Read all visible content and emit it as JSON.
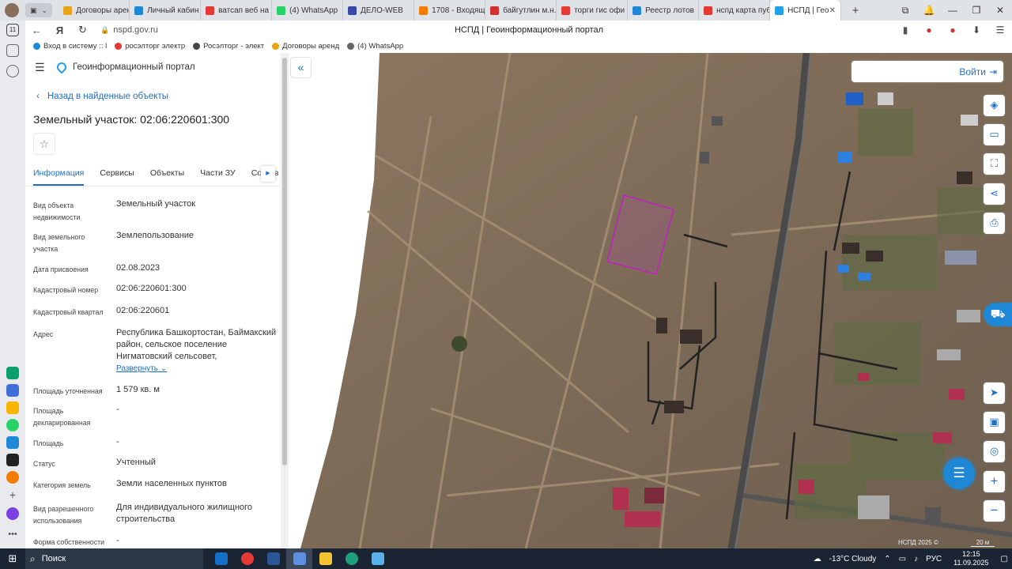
{
  "browser": {
    "tabs": [
      {
        "label": "Договоры арен",
        "color": "#e8a317"
      },
      {
        "label": "Личный кабин",
        "color": "#1e88d6"
      },
      {
        "label": "ватсап веб на",
        "color": "#e53935"
      },
      {
        "label": "(4) WhatsApp",
        "color": "#25d366"
      },
      {
        "label": "ДЕЛО-WEB",
        "color": "#3949ab"
      },
      {
        "label": "1708 - Входящ",
        "color": "#f57c00"
      },
      {
        "label": "байгутлин м.н.",
        "color": "#d32f2f"
      },
      {
        "label": "торги гис офи",
        "color": "#e53935"
      },
      {
        "label": "Реестр лотов",
        "color": "#1e88d6"
      },
      {
        "label": "нспд карта пуб",
        "color": "#e53935"
      }
    ],
    "active_tab": {
      "label": "НСПД | Гео",
      "color": "#1fa0e8"
    },
    "new_tab": "+",
    "url": "nspd.gov.ru",
    "page_title": "НСПД | Геоинформационный портал",
    "bookmarks": [
      {
        "label": "Вход в систему :: l",
        "color": "#1e88d6"
      },
      {
        "label": "росэлторг электр",
        "color": "#e53935"
      },
      {
        "label": "Росэлторг - элект",
        "color": "#444"
      },
      {
        "label": "Договоры аренд",
        "color": "#e8a317"
      },
      {
        "label": "(4) WhatsApp",
        "color": "#666"
      }
    ]
  },
  "portal": {
    "title": "Геоинформационный портал",
    "back_label": "Назад в найденные объекты",
    "object_title": "Земельный участок: 02:06:220601:300",
    "tabs": [
      "Информация",
      "Сервисы",
      "Объекты",
      "Части ЗУ",
      "Состав"
    ],
    "attributes": [
      {
        "label": "Вид объекта недвижимости",
        "value": "Земельный участок"
      },
      {
        "label": "Вид земельного участка",
        "value": "Землепользование"
      },
      {
        "label": "Дата присвоения",
        "value": "02.08.2023"
      },
      {
        "label": "Кадастровый номер",
        "value": "02:06:220601:300"
      },
      {
        "label": "Кадастровый квартал",
        "value": "02:06:220601"
      },
      {
        "label": "Адрес",
        "value": "Республика Башкортостан, Баймакский район, сельское поселение Нигматовский сельсовет,"
      },
      {
        "label": "Площадь уточненная",
        "value": "1 579 кв. м"
      },
      {
        "label": "Площадь декларированная",
        "value": "-"
      },
      {
        "label": "Площадь",
        "value": "-"
      },
      {
        "label": "Статус",
        "value": "Учтенный"
      },
      {
        "label": "Категория земель",
        "value": "Земли населенных пунктов"
      },
      {
        "label": "Вид разрешенного использования",
        "value": "Для индивидуального жилищного строительства"
      },
      {
        "label": "Форма собственности",
        "value": "-"
      }
    ],
    "expand_label": "Развернуть"
  },
  "map": {
    "search_button": "Войти",
    "copyright": "НСПД 2025 ©",
    "scale": "20 м",
    "parcel_color": "#c020c0",
    "tool_icons": [
      "layers-icon",
      "ruler-icon",
      "select-area-icon",
      "share-icon",
      "print-icon",
      "locate-icon",
      "picture-in-picture-icon",
      "geo-search-icon",
      "zoom-in-icon",
      "zoom-out-icon"
    ]
  },
  "taskbar": {
    "search_placeholder": "Поиск",
    "weather": "-13°C Cloudy",
    "lang": "РУС",
    "time": "12:15",
    "date": "11.09.2025",
    "notifications": "1"
  }
}
